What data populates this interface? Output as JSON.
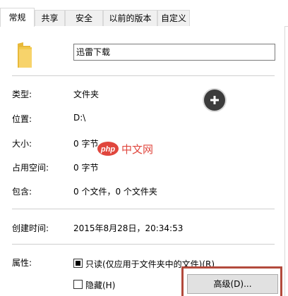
{
  "tabs": [
    "常规",
    "共享",
    "安全",
    "以前的版本",
    "自定义"
  ],
  "file_name": "迅雷下载",
  "rows": {
    "type": {
      "label": "类型:",
      "value": "文件夹"
    },
    "location": {
      "label": "位置:",
      "value": "D:\\"
    },
    "size": {
      "label": "大小:",
      "value": "0 字节"
    },
    "size_on_disk": {
      "label": "占用空间:",
      "value": "0 字节"
    },
    "contains": {
      "label": "包含:",
      "value": "0 个文件，0 个文件夹"
    },
    "created": {
      "label": "创建时间:",
      "value": "2015年8月28日，20:34:53"
    }
  },
  "attributes": {
    "label": "属性:",
    "readonly": {
      "label": "只读(仅应用于文件夹中的文件)(R)",
      "state": "indeterminate"
    },
    "hidden": {
      "label": "隐藏(H)",
      "checked": false
    },
    "advanced_button": "高级(D)..."
  },
  "watermark": {
    "logo_text": "php",
    "site_text": "中文网"
  },
  "colors": {
    "folder": "#f2c94c",
    "highlight": "#b34a3c",
    "watermark": "#e0463d"
  }
}
